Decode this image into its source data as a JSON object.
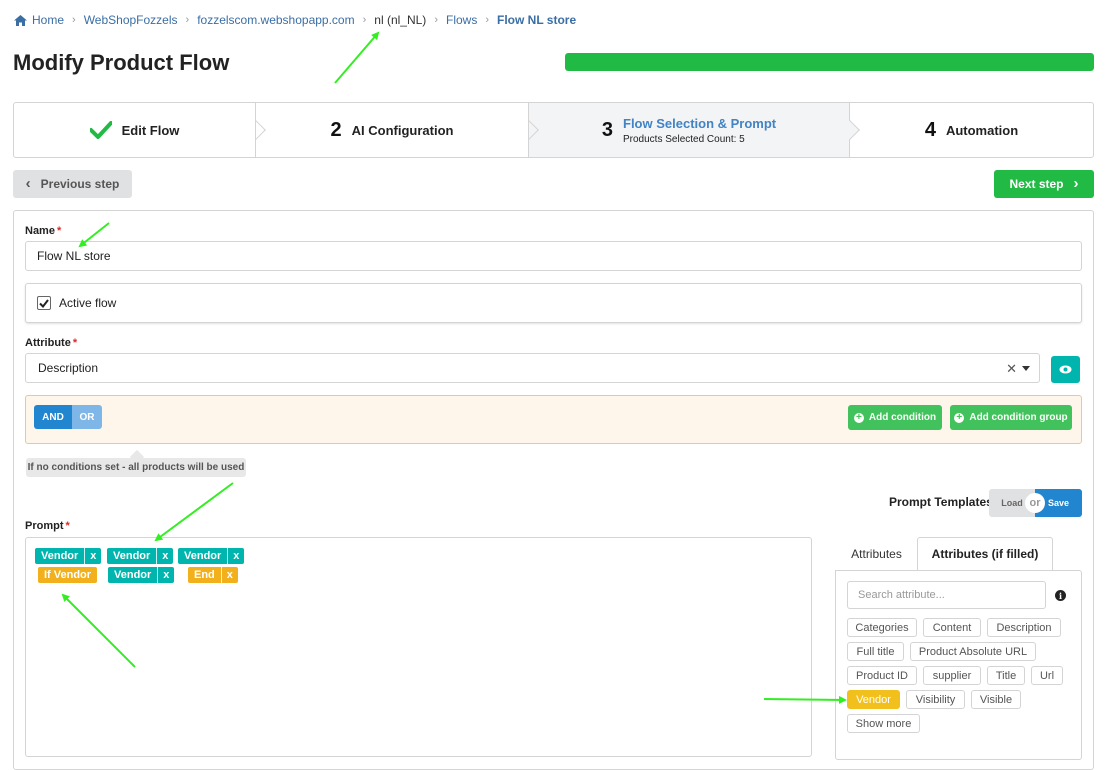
{
  "breadcrumb": {
    "items": [
      {
        "label": "Home"
      },
      {
        "label": "WebShopFozzels"
      },
      {
        "label": "fozzelscom.webshopapp.com"
      },
      {
        "label": "nl (nl_NL)"
      },
      {
        "label": "Flows"
      },
      {
        "label": "Flow NL store"
      }
    ]
  },
  "page": {
    "title": "Modify Product Flow",
    "progress_fraction": 1.0
  },
  "steps": [
    {
      "label": "Edit Flow",
      "icon": "check-icon"
    },
    {
      "num": "2",
      "label": "AI Configuration"
    },
    {
      "num": "3",
      "label": "Flow Selection & Prompt",
      "desc": "Products Selected Count: 5",
      "active": true
    },
    {
      "num": "4",
      "label": "Automation"
    }
  ],
  "nav": {
    "prev": "Previous step",
    "next": "Next step"
  },
  "form": {
    "name_label": "Name",
    "name_value": "Flow NL store",
    "active_label": "Active flow",
    "active_checked": true,
    "attribute_label": "Attribute",
    "attribute_value": "Description",
    "and_label": "AND",
    "or_label": "OR",
    "add_condition": "Add condition",
    "add_condition_group": "Add condition group",
    "hint": "If no conditions set - all products will be used",
    "prompt_label": "Prompt",
    "prompt_templates_label": "Prompt Templates",
    "load_label": "Load",
    "or_divider": "or",
    "save_label": "Save"
  },
  "prompt_tags": [
    {
      "label": "Vendor",
      "color": "#00b5ad"
    },
    {
      "label": "Vendor",
      "color": "#00b5ad"
    },
    {
      "label": "Vendor",
      "color": "#00b5ad"
    },
    {
      "label": "If Vendor",
      "color": "#f2b01c"
    },
    {
      "label": "Vendor",
      "color": "#00b5ad"
    },
    {
      "label": "End",
      "color": "#f2b01c"
    }
  ],
  "tag_remove": "x",
  "attr_tabs": [
    {
      "label": "Attributes"
    },
    {
      "label": "Attributes (if filled)",
      "active": true
    }
  ],
  "attr_search_placeholder": "Search attribute...",
  "attributes": [
    "Categories",
    "Content",
    "Description",
    "Full title",
    "Product Absolute URL",
    "Product ID",
    "supplier",
    "Title",
    "Url",
    "Vendor",
    "Visibility",
    "Visible"
  ],
  "highlighted_attribute": "Vendor",
  "show_more": "Show more",
  "colors": {
    "green": "#21ba45",
    "teal": "#00b5ad",
    "yellow": "#f2b01c",
    "blue": "#2185d0",
    "link": "#3a6ea5",
    "annotation_arrow": "#33ee22"
  }
}
